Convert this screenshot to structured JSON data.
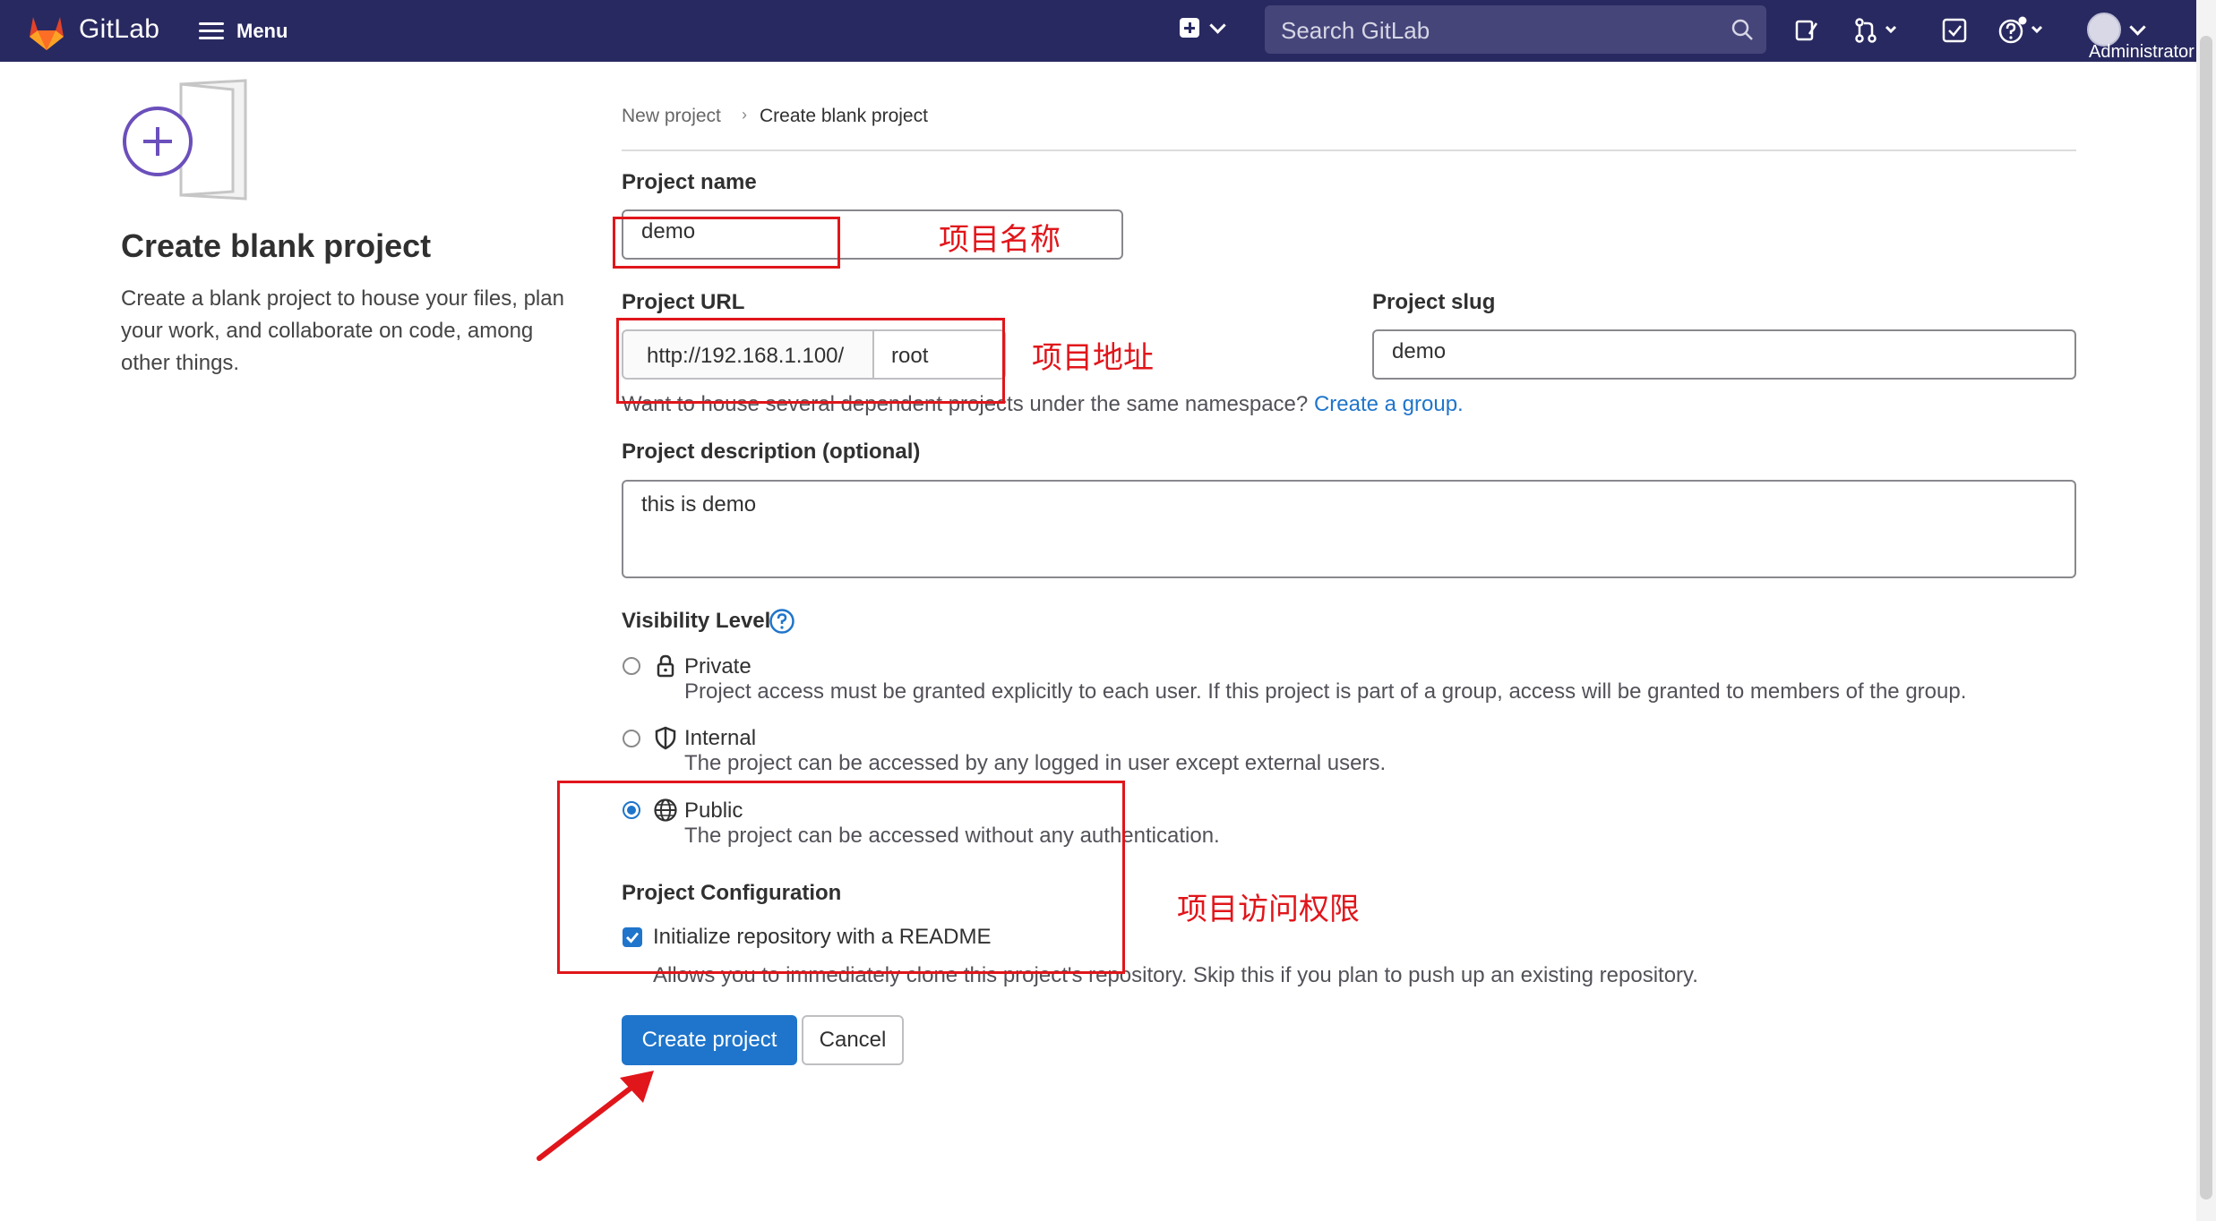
{
  "nav": {
    "brand": "GitLab",
    "menu_label": "Menu",
    "search_placeholder": "Search GitLab",
    "user_name": "Administrator"
  },
  "sidebar": {
    "title": "Create blank project",
    "description": "Create a blank project to house your files, plan your work, and collaborate on code, among other things."
  },
  "breadcrumb": {
    "items": [
      "New project",
      "Create blank project"
    ],
    "separator": "›"
  },
  "form": {
    "project_name_label": "Project name",
    "project_name_value": "demo",
    "project_url_label": "Project URL",
    "project_url_prefix": "http://192.168.1.100/",
    "project_url_namespace": "root",
    "project_slug_label": "Project slug",
    "project_slug_value": "demo",
    "namespace_hint": "Want to house several dependent projects under the same namespace?",
    "namespace_hint_link": "Create a group.",
    "description_label": "Project description (optional)",
    "description_value": "this is demo",
    "visibility_label": "Visibility Level",
    "visibility_options": [
      {
        "title": "Private",
        "desc": "Project access must be granted explicitly to each user. If this project is part of a group, access will be granted to members of the group.",
        "selected": false
      },
      {
        "title": "Internal",
        "desc": "The project can be accessed by any logged in user except external users.",
        "selected": false
      },
      {
        "title": "Public",
        "desc": "The project can be accessed without any authentication.",
        "selected": true
      }
    ],
    "config_label": "Project Configuration",
    "readme_label": "Initialize repository with a README",
    "readme_checked": true,
    "readme_hint": "Allows you to immediately clone this project's repository. Skip this if you plan to push up an existing repository.",
    "create_button": "Create project",
    "cancel_button": "Cancel"
  },
  "annotations": {
    "name_note": "项目名称",
    "url_note": "项目地址",
    "access_note": "项目访问权限",
    "color": "#e0161b"
  },
  "colors": {
    "nav_bg": "#292961",
    "primary": "#1f75cb",
    "link": "#1f75cb"
  }
}
